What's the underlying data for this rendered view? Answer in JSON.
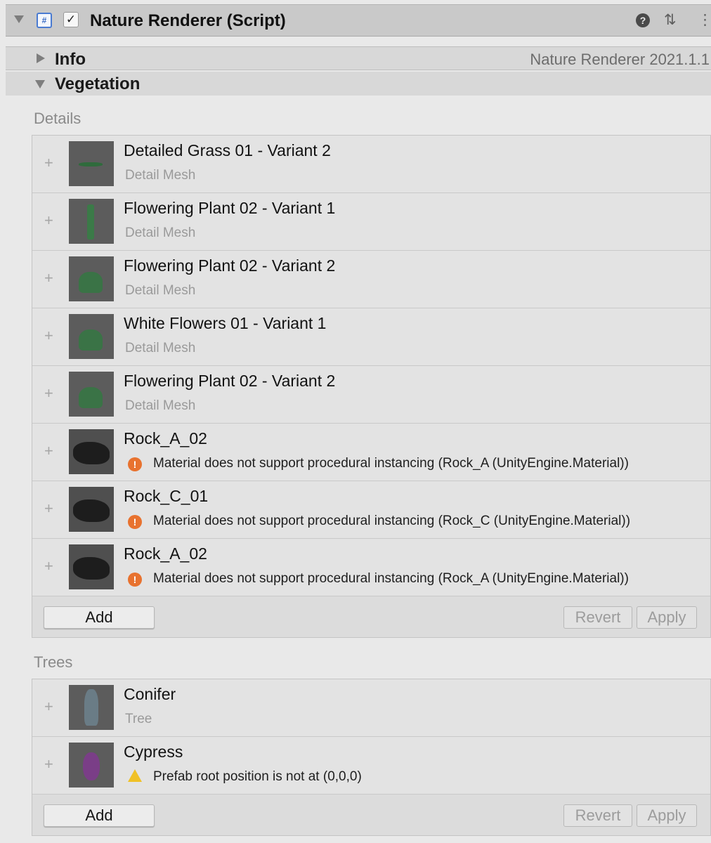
{
  "component": {
    "title": "Nature Renderer (Script)",
    "enabled": true,
    "icons": [
      "fold-arrow-icon",
      "csharp-script-icon",
      "checkbox-icon",
      "help-icon",
      "preset-icon",
      "kebab-menu-icon"
    ]
  },
  "sections": {
    "info": {
      "label": "Info",
      "version": "Nature Renderer 2021.1.1"
    },
    "vegetation": {
      "label": "Vegetation"
    }
  },
  "details": {
    "label": "Details",
    "items": [
      {
        "name": "Detailed Grass 01 - Variant 2",
        "subtitle": "Detail Mesh"
      },
      {
        "name": "Flowering Plant 02 - Variant 1",
        "subtitle": "Detail Mesh"
      },
      {
        "name": "Flowering Plant 02 - Variant 2",
        "subtitle": "Detail Mesh"
      },
      {
        "name": "White Flowers 01 - Variant 1",
        "subtitle": "Detail Mesh"
      },
      {
        "name": "Flowering Plant 02 - Variant 2",
        "subtitle": "Detail Mesh"
      },
      {
        "name": "Rock_A_02",
        "error": "Material does not support procedural instancing (Rock_A (UnityEngine.Material))"
      },
      {
        "name": "Rock_C_01",
        "error": "Material does not support procedural instancing (Rock_C (UnityEngine.Material))"
      },
      {
        "name": "Rock_A_02",
        "error": "Material does not support procedural instancing (Rock_A (UnityEngine.Material))"
      }
    ],
    "buttons": {
      "add": "Add",
      "revert": "Revert",
      "apply": "Apply"
    }
  },
  "trees": {
    "label": "Trees",
    "items": [
      {
        "name": "Conifer",
        "subtitle": "Tree"
      },
      {
        "name": "Cypress",
        "warning": "Prefab root position is not at (0,0,0)"
      }
    ],
    "buttons": {
      "add": "Add",
      "revert": "Revert",
      "apply": "Apply"
    }
  },
  "colors": {
    "error": "#e8722f",
    "warning": "#f0c126",
    "accent": "#4a7bd1"
  }
}
